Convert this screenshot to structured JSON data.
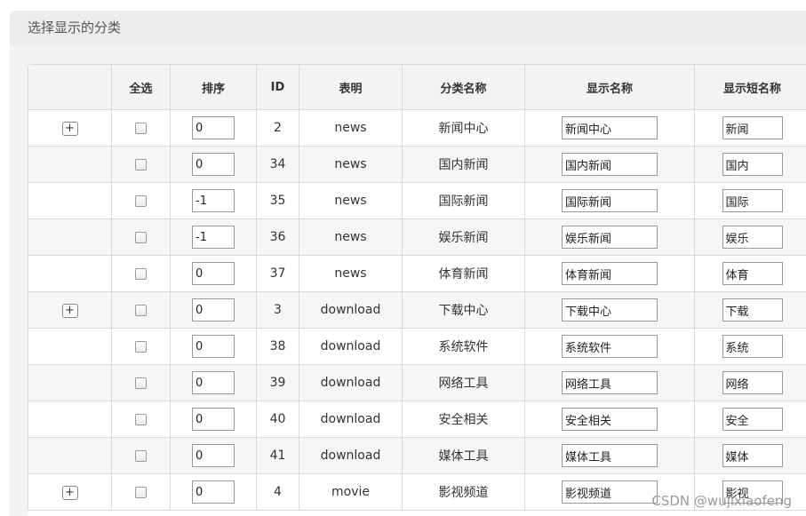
{
  "panel": {
    "title": "选择显示的分类"
  },
  "table": {
    "headers": [
      "",
      "全选",
      "排序",
      "ID",
      "表明",
      "分类名称",
      "显示名称",
      "显示短名称"
    ],
    "rows": [
      {
        "expand": "+",
        "sort": "0",
        "id": "2",
        "table": "news",
        "category": "新闻中心",
        "display": "新闻中心",
        "short": "新闻"
      },
      {
        "expand": "",
        "sort": "0",
        "id": "34",
        "table": "news",
        "category": "国内新闻",
        "display": "国内新闻",
        "short": "国内"
      },
      {
        "expand": "",
        "sort": "-1",
        "id": "35",
        "table": "news",
        "category": "国际新闻",
        "display": "国际新闻",
        "short": "国际"
      },
      {
        "expand": "",
        "sort": "-1",
        "id": "36",
        "table": "news",
        "category": "娱乐新闻",
        "display": "娱乐新闻",
        "short": "娱乐"
      },
      {
        "expand": "",
        "sort": "0",
        "id": "37",
        "table": "news",
        "category": "体育新闻",
        "display": "体育新闻",
        "short": "体育"
      },
      {
        "expand": "+",
        "sort": "0",
        "id": "3",
        "table": "download",
        "category": "下载中心",
        "display": "下载中心",
        "short": "下载"
      },
      {
        "expand": "",
        "sort": "0",
        "id": "38",
        "table": "download",
        "category": "系统软件",
        "display": "系统软件",
        "short": "系统"
      },
      {
        "expand": "",
        "sort": "0",
        "id": "39",
        "table": "download",
        "category": "网络工具",
        "display": "网络工具",
        "short": "网络"
      },
      {
        "expand": "",
        "sort": "0",
        "id": "40",
        "table": "download",
        "category": "安全相关",
        "display": "安全相关",
        "short": "安全"
      },
      {
        "expand": "",
        "sort": "0",
        "id": "41",
        "table": "download",
        "category": "媒体工具",
        "display": "媒体工具",
        "short": "媒体"
      },
      {
        "expand": "+",
        "sort": "0",
        "id": "4",
        "table": "movie",
        "category": "影视频道",
        "display": "影视频道",
        "short": "影视"
      }
    ]
  },
  "watermark": "CSDN @wujixiaofeng"
}
